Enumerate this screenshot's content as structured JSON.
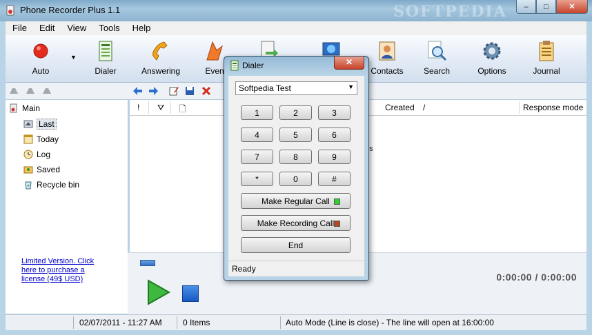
{
  "window": {
    "title": "Phone Recorder Plus 1.1",
    "watermark": "SOFTPEDIA",
    "min": "–",
    "max": "□",
    "close": "✕"
  },
  "menu": [
    "File",
    "Edit",
    "View",
    "Tools",
    "Help"
  ],
  "toolbar": {
    "auto": "Auto",
    "dialer": "Dialer",
    "answering": "Answering",
    "events": "Even",
    "contacts": "Contacts",
    "search": "Search",
    "options": "Options",
    "journal": "Journal"
  },
  "tree": {
    "items": [
      {
        "label": "Main"
      },
      {
        "label": "Last"
      },
      {
        "label": "Today"
      },
      {
        "label": "Log"
      },
      {
        "label": "Saved"
      },
      {
        "label": "Recycle bin"
      }
    ],
    "license": "Limited Version. Click here to purchase a license (49$ USD)"
  },
  "list": {
    "headers": {
      "priority": "!",
      "flag": "⛛",
      "file": "🗋",
      "created": "Created",
      "sort": "/",
      "response": "Response mode"
    },
    "empty_text": "ms"
  },
  "player": {
    "time": "0:00:00  /  0:00:00",
    "progress": 0.03
  },
  "statusbar": {
    "datetime": "02/07/2011 - 11:27 AM",
    "items": "0 Items",
    "mode": "Auto Mode (Line is close) - The line will open at 16:00:00"
  },
  "dialer": {
    "title": "Dialer",
    "close": "✕",
    "selected_contact": "Softpedia Test",
    "keys": [
      "1",
      "2",
      "3",
      "4",
      "5",
      "6",
      "7",
      "8",
      "9",
      "*",
      "0",
      "#"
    ],
    "regular_call": "Make Regular Call",
    "recording_call": "Make Recording Call",
    "end": "End",
    "status": "Ready",
    "colors": {
      "regular_led": "#2fd22f",
      "recording_led": "#b8461e"
    }
  }
}
